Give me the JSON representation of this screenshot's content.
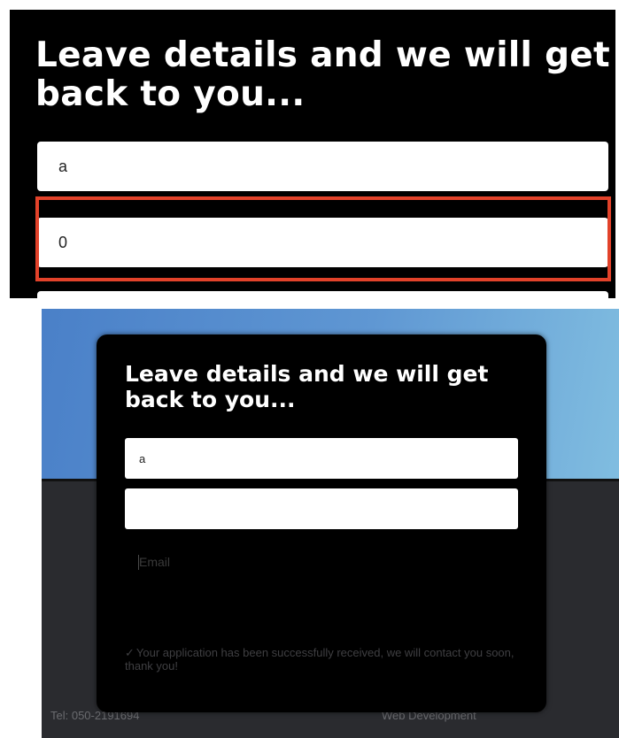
{
  "zoom": {
    "heading": "Leave details and we will get back to you...",
    "name_value": "a",
    "phone_value": "0"
  },
  "colors": {
    "highlight": "#e2422a",
    "hero_start": "#4a80c8",
    "hero_end": "#80bde0",
    "page_bg": "#2a2b2f",
    "modal_bg": "#000000"
  },
  "form": {
    "heading": "Leave details and we will get back to you...",
    "name_value": "a",
    "phone_value": "",
    "email_placeholder": "Email",
    "success_icon": "check-icon",
    "success_message": "Your application has been successfully received, we will contact you soon, thank you!"
  },
  "footer": {
    "tel": "Tel: 050-2191694",
    "web": "Web Development"
  }
}
